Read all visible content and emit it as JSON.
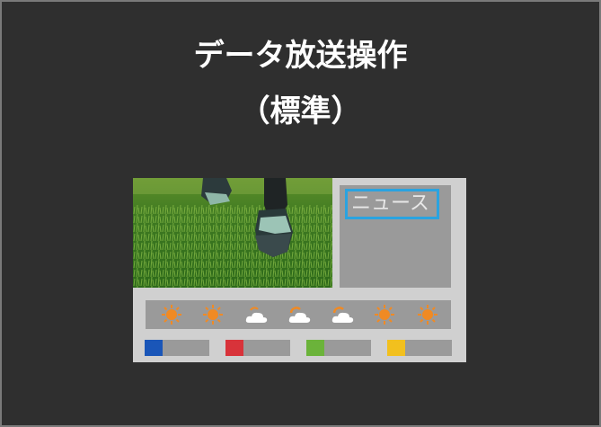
{
  "title": {
    "line1": "データ放送操作",
    "line2": "（標準）"
  },
  "screen": {
    "video_description_icon": "running-feet-on-grass",
    "news_button_label": "ニュース",
    "weather": [
      {
        "icon": "sun-icon"
      },
      {
        "icon": "sun-icon"
      },
      {
        "icon": "cloudy-icon"
      },
      {
        "icon": "partly-cloudy-icon"
      },
      {
        "icon": "partly-cloudy-icon"
      },
      {
        "icon": "sun-icon"
      },
      {
        "icon": "sun-icon"
      }
    ],
    "color_buttons": [
      {
        "name": "blue",
        "color": "#1a56b8"
      },
      {
        "name": "red",
        "color": "#d8333a"
      },
      {
        "name": "green",
        "color": "#6bb33a"
      },
      {
        "name": "yellow",
        "color": "#f2c01e"
      }
    ],
    "accent_color": "#2aa3e0"
  }
}
